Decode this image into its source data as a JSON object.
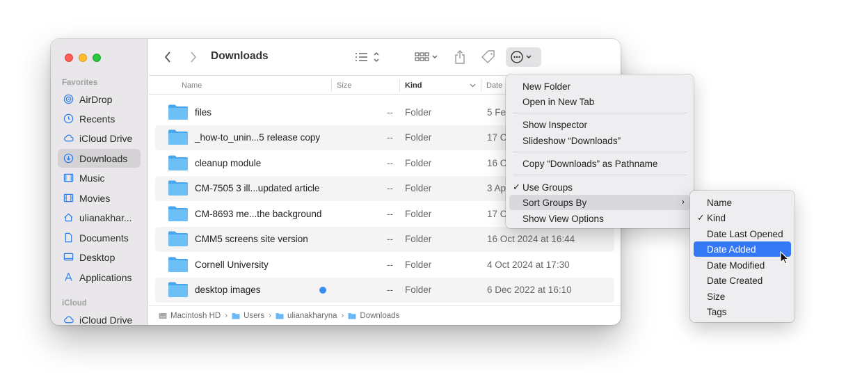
{
  "window": {
    "title": "Downloads",
    "sidebar": {
      "sections": [
        {
          "label": "Favorites",
          "items": [
            {
              "label": "AirDrop",
              "icon": "airdrop-icon"
            },
            {
              "label": "Recents",
              "icon": "clock-icon"
            },
            {
              "label": "iCloud Drive",
              "icon": "cloud-icon"
            },
            {
              "label": "Downloads",
              "icon": "download-icon",
              "active": true
            },
            {
              "label": "Music",
              "icon": "music-icon"
            },
            {
              "label": "Movies",
              "icon": "film-icon"
            },
            {
              "label": "ulianakhar...",
              "icon": "home-icon"
            },
            {
              "label": "Documents",
              "icon": "document-icon"
            },
            {
              "label": "Desktop",
              "icon": "desktop-icon"
            },
            {
              "label": "Applications",
              "icon": "applications-icon"
            }
          ]
        },
        {
          "label": "iCloud",
          "items": [
            {
              "label": "iCloud Drive",
              "icon": "cloud-icon"
            }
          ]
        }
      ]
    },
    "columns": {
      "name": "Name",
      "size": "Size",
      "kind": "Kind",
      "date": "Date"
    },
    "files": [
      {
        "name": "files",
        "size": "--",
        "kind": "Folder",
        "date": "5 Fe"
      },
      {
        "name": "_how-to_unin...5 release copy",
        "size": "--",
        "kind": "Folder",
        "date": "17 O"
      },
      {
        "name": "cleanup module",
        "size": "--",
        "kind": "Folder",
        "date": "16 O"
      },
      {
        "name": "CM-7505 3 ill...updated article",
        "size": "--",
        "kind": "Folder",
        "date": "3 Ap"
      },
      {
        "name": "CM-8693 me...the background",
        "size": "--",
        "kind": "Folder",
        "date": "17 O"
      },
      {
        "name": "CMM5 screens site version",
        "size": "--",
        "kind": "Folder",
        "date": "16 Oct 2024 at 16:44"
      },
      {
        "name": "Cornell University",
        "size": "--",
        "kind": "Folder",
        "date": "4 Oct 2024 at 17:30"
      },
      {
        "name": "desktop images",
        "size": "--",
        "kind": "Folder",
        "date": "6 Dec 2022 at 16:10",
        "tag_color": "#3b8ef3"
      }
    ],
    "path": [
      "Macintosh HD",
      "Users",
      "ulianakharyna",
      "Downloads"
    ]
  },
  "action_menu": {
    "groups": [
      [
        "New Folder",
        "Open in New Tab"
      ],
      [
        "Show Inspector",
        "Slideshow “Downloads”"
      ],
      [
        "Copy “Downloads” as Pathname"
      ],
      [
        "Use Groups",
        "Sort Groups By",
        "Show View Options"
      ]
    ],
    "checked": "Use Groups",
    "highlighted": "Sort Groups By"
  },
  "sort_submenu": {
    "items": [
      "Name",
      "Kind",
      "Date Last Opened",
      "Date Added",
      "Date Modified",
      "Date Created",
      "Size",
      "Tags"
    ],
    "checked": "Kind",
    "selected": "Date Added"
  },
  "colors": {
    "accent": "#3478f6",
    "folder": "#5db4f3",
    "sidebar_bg": "#e9e7e9"
  }
}
